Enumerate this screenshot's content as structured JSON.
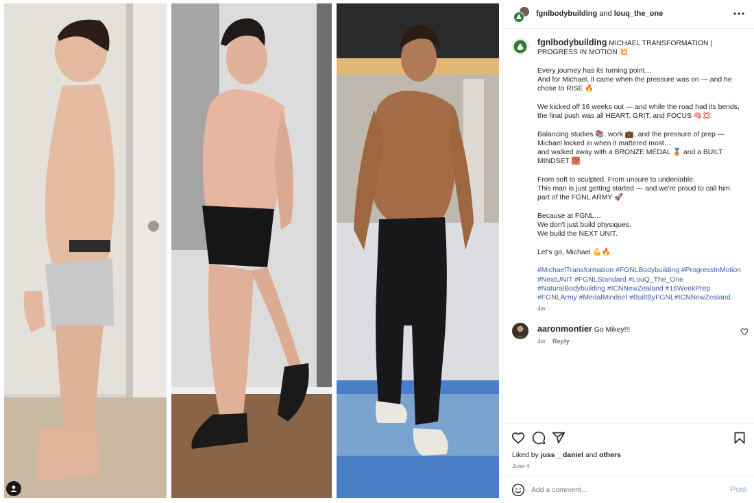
{
  "header": {
    "username": "fgnlbodybuilding",
    "joiner": "and",
    "collaborator": "louq_the_one",
    "more_icon": "more-horizontal-icon"
  },
  "caption": {
    "owner": "fgnlbodybuilding",
    "title": "MICHAEL TRANSFORMATION | PROGRESS IN MOTION 💥",
    "lines": [
      "Every journey has its turning point…",
      "And for Michael, it came when the pressure was on — and he chose to RISE 🔥",
      "",
      "We kicked off 16 weeks out — and while the road had its bends, the final push was all HEART, GRIT, and FOCUS 🧠💢",
      "",
      "Balancing studies 📚, work 💼, and the pressure of prep — Michael locked in when it mattered most…",
      "and walked away with a BRONZE MEDAL 🥉 and a BUILT MINDSET 🧱",
      "",
      "From soft to sculpted. From unsure to undeniable.",
      "This man is just getting started — and we're proud to call him part of the FGNL ARMY 🚀",
      "",
      "Because at FGNL…",
      "We don't just build physiques.",
      "We build the NEXT UNIT.",
      "",
      "Let's go, Michael 💪🔥",
      ""
    ],
    "hashtags": "#MichaelTransformation #FGNLBodybuilding #ProgressInMotion #NextUNIT #FGNLStandard #LouQ_The_One #NaturalBodybuilding #ICNNewZealand #16WeekPrep #FGNLArmy #MedalMindset #BuiltByFGNL#ICNNewZealand",
    "ago": "4w"
  },
  "comment": {
    "username": "aaronmontier",
    "text": "Go Mikey!!!",
    "ago": "4w",
    "reply_label": "Reply"
  },
  "actions": {
    "liked_prefix": "Liked by",
    "liked_user": "juss__daniel",
    "liked_joiner": "and",
    "liked_others": "others",
    "date": "June 4"
  },
  "comment_bar": {
    "placeholder": "Add a comment...",
    "post_label": "Post"
  },
  "colors": {
    "text": "#262626",
    "muted": "#737373",
    "hashtag": "#3f5fa6",
    "post_disabled": "#8fb6ec",
    "brand_green": "#2e7d32"
  }
}
